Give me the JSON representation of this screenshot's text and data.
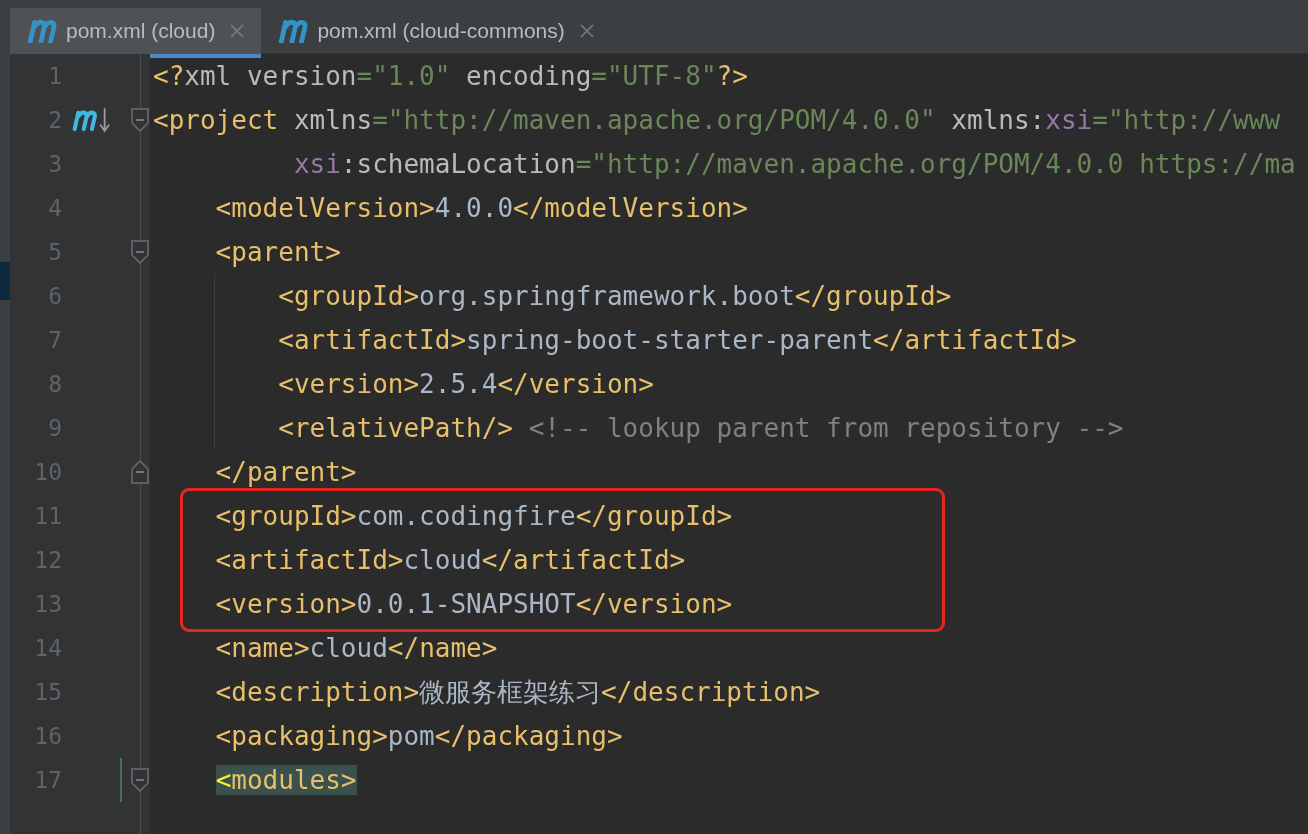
{
  "tabs": [
    {
      "label": "pom.xml (cloud)",
      "selected": true
    },
    {
      "label": "pom.xml (cloud-commons)",
      "selected": false
    }
  ],
  "lines": [
    {
      "number": "1",
      "tokens": [
        {
          "kind": "tag",
          "text": "<?"
        },
        {
          "kind": "attr",
          "text": "xml version"
        },
        {
          "kind": "value",
          "text": "=\"1.0\""
        },
        {
          "kind": "attr",
          "text": " encoding"
        },
        {
          "kind": "value",
          "text": "=\"UTF-8\""
        },
        {
          "kind": "tag",
          "text": "?>"
        }
      ]
    },
    {
      "number": "2",
      "maven_marker": true,
      "fold_open": true,
      "tokens": [
        {
          "kind": "tag",
          "text": "<project"
        },
        {
          "kind": "attr",
          "text": " xmlns"
        },
        {
          "kind": "value",
          "text": "=\"http://maven.apache.org/POM/4.0.0\""
        },
        {
          "kind": "attr",
          "text": " xmlns:"
        },
        {
          "kind": "ns",
          "text": "xsi"
        },
        {
          "kind": "value",
          "text": "=\"http://www"
        }
      ]
    },
    {
      "number": "3",
      "tokens": [
        {
          "kind": "ns",
          "text": "         xsi"
        },
        {
          "kind": "attr",
          "text": ":schemaLocation"
        },
        {
          "kind": "value",
          "text": "=\"http://maven.apache.org/POM/4.0.0 https://ma"
        }
      ]
    },
    {
      "number": "4",
      "tokens": [
        {
          "kind": "tag",
          "text": "    <modelVersion>"
        },
        {
          "kind": "text",
          "text": "4.0.0"
        },
        {
          "kind": "tag",
          "text": "</modelVersion>"
        }
      ]
    },
    {
      "number": "5",
      "fold_open": true,
      "tokens": [
        {
          "kind": "tag",
          "text": "    <parent>"
        }
      ]
    },
    {
      "number": "6",
      "guide": true,
      "tokens": [
        {
          "kind": "tag",
          "text": "        <groupId>"
        },
        {
          "kind": "text",
          "text": "org.springframework.boot"
        },
        {
          "kind": "tag",
          "text": "</groupId>"
        }
      ]
    },
    {
      "number": "7",
      "guide": true,
      "tokens": [
        {
          "kind": "tag",
          "text": "        <artifactId>"
        },
        {
          "kind": "text",
          "text": "spring-boot-starter-parent"
        },
        {
          "kind": "tag",
          "text": "</artifactId>"
        }
      ]
    },
    {
      "number": "8",
      "guide": true,
      "tokens": [
        {
          "kind": "tag",
          "text": "        <version>"
        },
        {
          "kind": "text",
          "text": "2.5.4"
        },
        {
          "kind": "tag",
          "text": "</version>"
        }
      ]
    },
    {
      "number": "9",
      "guide": true,
      "tokens": [
        {
          "kind": "tag",
          "text": "        <relativePath/>"
        },
        {
          "kind": "comment",
          "text": " <!-- lookup parent from repository -->"
        }
      ]
    },
    {
      "number": "10",
      "fold_close": true,
      "tokens": [
        {
          "kind": "tag",
          "text": "    </parent>"
        }
      ]
    },
    {
      "number": "11",
      "boxed": true,
      "tokens": [
        {
          "kind": "tag",
          "text": "    <groupId>"
        },
        {
          "kind": "text",
          "text": "com.codingfire"
        },
        {
          "kind": "tag",
          "text": "</groupId>"
        }
      ]
    },
    {
      "number": "12",
      "boxed": true,
      "tokens": [
        {
          "kind": "tag",
          "text": "    <artifactId>"
        },
        {
          "kind": "text",
          "text": "cloud"
        },
        {
          "kind": "tag",
          "text": "</artifactId>"
        }
      ]
    },
    {
      "number": "13",
      "boxed": true,
      "tokens": [
        {
          "kind": "tag",
          "text": "    <version>"
        },
        {
          "kind": "text",
          "text": "0.0.1-SNAPSHOT"
        },
        {
          "kind": "tag",
          "text": "</version>"
        }
      ]
    },
    {
      "number": "14",
      "tokens": [
        {
          "kind": "tag",
          "text": "    <name>"
        },
        {
          "kind": "text",
          "text": "cloud"
        },
        {
          "kind": "tag",
          "text": "</name>"
        }
      ]
    },
    {
      "number": "15",
      "tokens": [
        {
          "kind": "tag",
          "text": "    <description>"
        },
        {
          "kind": "text",
          "text": "微服务框架练习"
        },
        {
          "kind": "tag",
          "text": "</description>"
        }
      ]
    },
    {
      "number": "16",
      "tokens": [
        {
          "kind": "tag",
          "text": "    <packaging>"
        },
        {
          "kind": "text",
          "text": "pom"
        },
        {
          "kind": "tag",
          "text": "</packaging>"
        }
      ]
    },
    {
      "number": "17",
      "fold_open": true,
      "changed": true,
      "tokens": [
        {
          "kind": "match_bracket",
          "text": "    <"
        },
        {
          "kind": "match",
          "text": "modules>"
        }
      ]
    }
  ]
}
